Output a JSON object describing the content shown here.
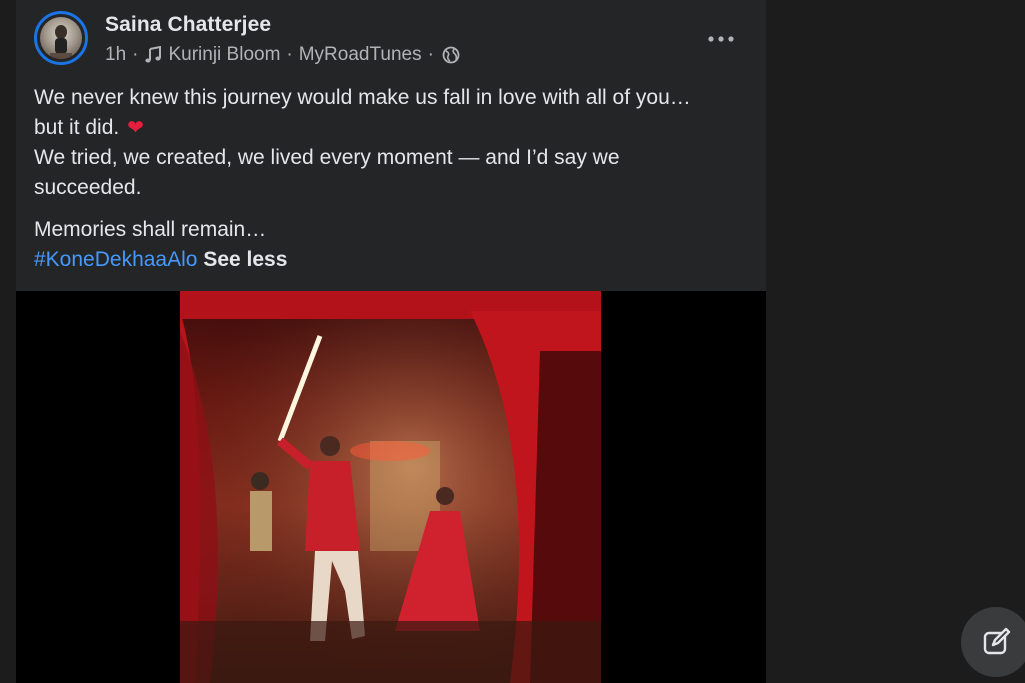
{
  "post": {
    "author": "Saina Chatterjee",
    "time": "1h",
    "song": "Kurinji Bloom",
    "channel": "MyRoadTunes",
    "separator": "·",
    "audience_icon": "globe-icon",
    "music_icon": "music-note-icon",
    "more_icon": "more-options-icon",
    "lines": [
      "We never knew this journey would make us fall in love with all of you…",
      "but it did.",
      "We tried, we created, we lived every moment — and I’d say we",
      "succeeded.",
      "Memories shall remain…"
    ],
    "heart": "❤",
    "hashtag": "#KoneDekhaaAlo",
    "see_less": "See less"
  },
  "compose_icon": "new-message-icon",
  "colors": {
    "background": "#1c1c1d",
    "card": "#242526",
    "link": "#4599ff",
    "ring": "#1b74e4"
  }
}
